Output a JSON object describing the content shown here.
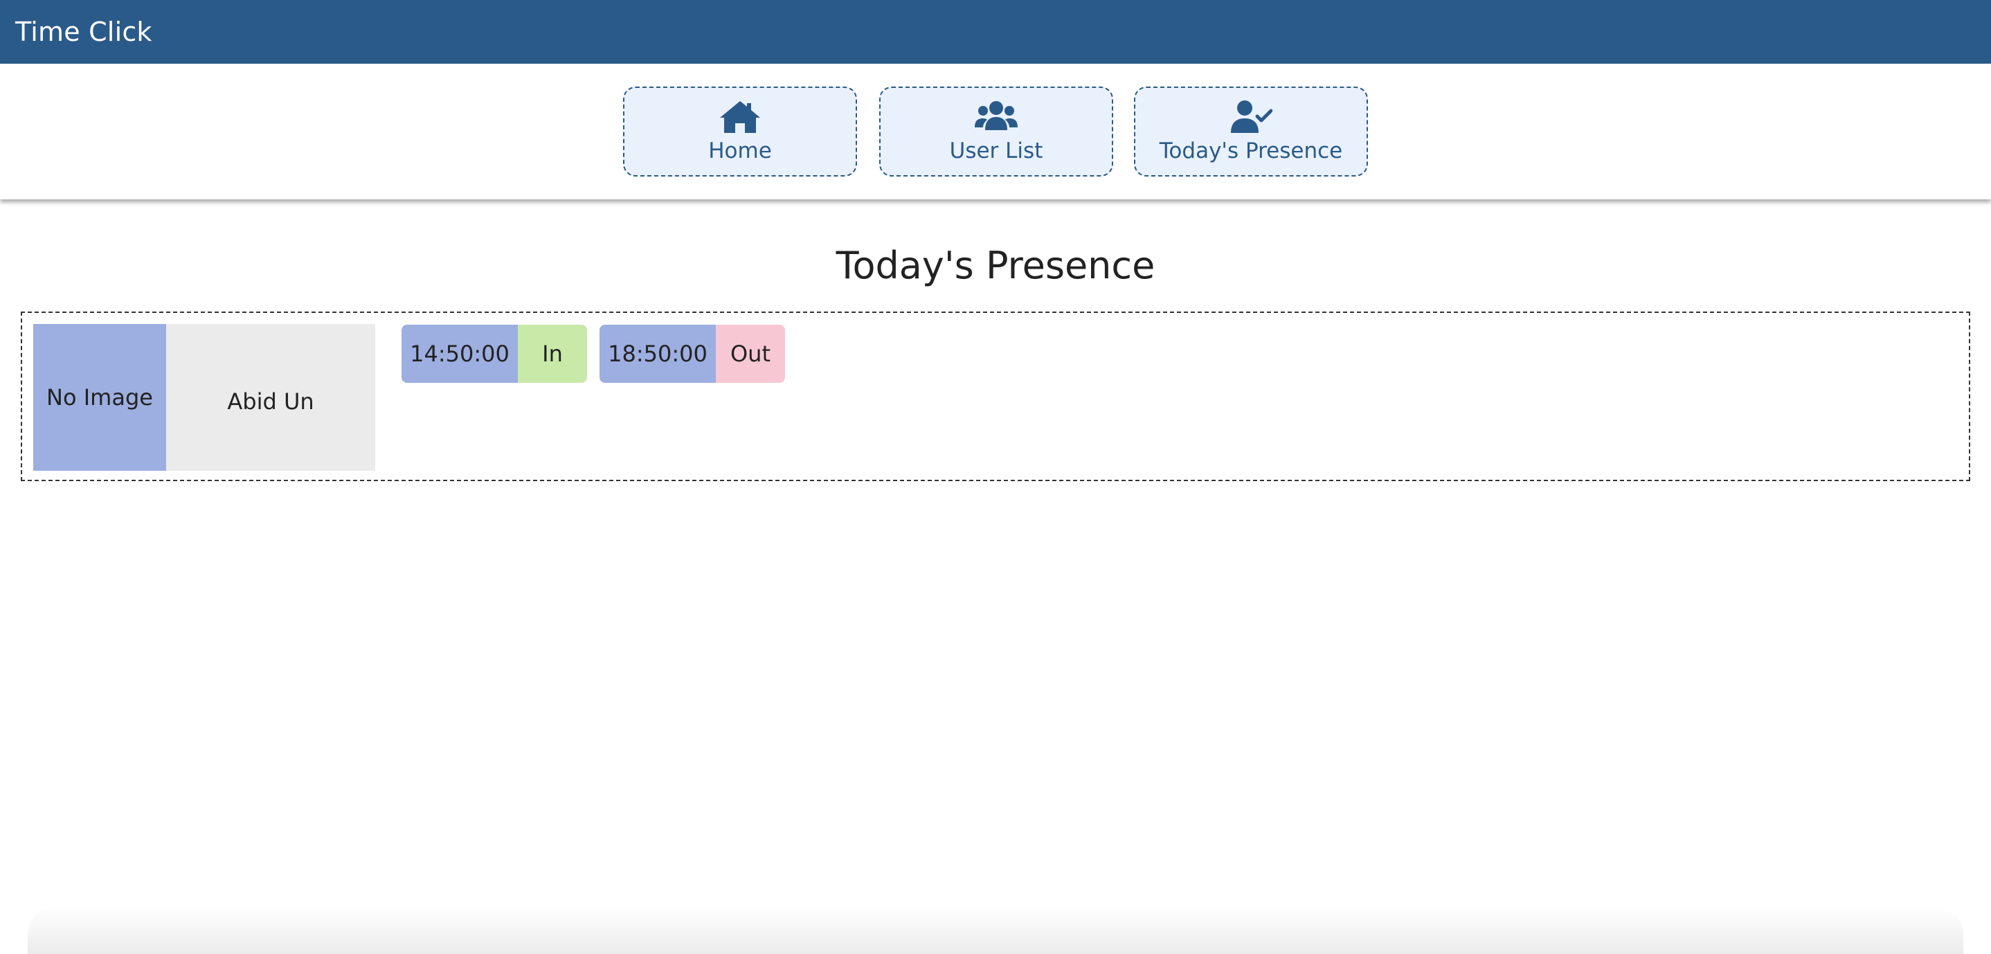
{
  "app": {
    "title": "Time Click"
  },
  "nav": {
    "items": [
      {
        "label": "Home",
        "icon": "home-icon"
      },
      {
        "label": "User List",
        "icon": "users-icon"
      },
      {
        "label": "Today's Presence",
        "icon": "user-check-icon"
      }
    ]
  },
  "main": {
    "title": "Today's Presence",
    "users": [
      {
        "image_placeholder": "No Image",
        "name": "Abid Un",
        "records": [
          {
            "time": "14:50:00",
            "status": "In"
          },
          {
            "time": "18:50:00",
            "status": "Out"
          }
        ]
      }
    ]
  },
  "colors": {
    "header": "#2a5a89",
    "nav_button_bg": "#e9f1fc",
    "time_bg": "#9daee0",
    "in_bg": "#c8e9a8",
    "out_bg": "#f7c8d3",
    "name_bg": "#ebebeb"
  }
}
